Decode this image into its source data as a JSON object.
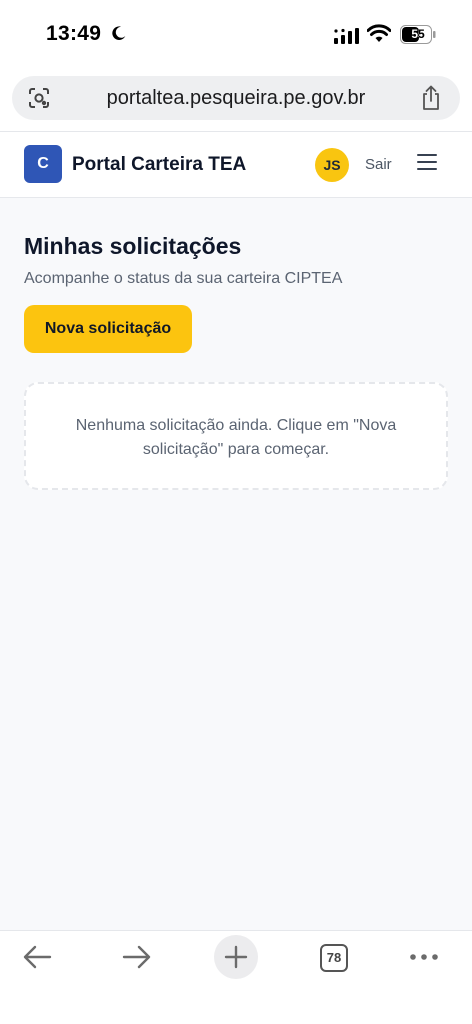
{
  "status_bar": {
    "time": "13:49",
    "battery": "55",
    "icons": [
      "moon-icon",
      "signal-icon",
      "wifi-icon",
      "battery-icon"
    ]
  },
  "browser": {
    "url": "portaltea.pesqueira.pe.gov.br",
    "tabs_count": "78",
    "icons": [
      "lens-icon",
      "share-icon",
      "back-arrow-icon",
      "forward-arrow-icon",
      "plus-icon",
      "more-icon"
    ]
  },
  "header": {
    "logo_letter": "C",
    "title": "Portal Carteira TEA",
    "avatar_initials": "JS",
    "logout_label": "Sair",
    "menu_icon": "hamburger-menu-icon"
  },
  "main": {
    "title": "Minhas solicitações",
    "subtitle": "Acompanhe o status da sua carteira CIPTEA",
    "new_request_label": "Nova solicitação",
    "empty_message": "Nenhuma solicitação ainda. Clique em \"Nova solicitação\" para começar."
  },
  "colors": {
    "accent_yellow": "#fcc40f",
    "brand_blue": "#2f56b6",
    "page_background": "#f8f9fb"
  }
}
